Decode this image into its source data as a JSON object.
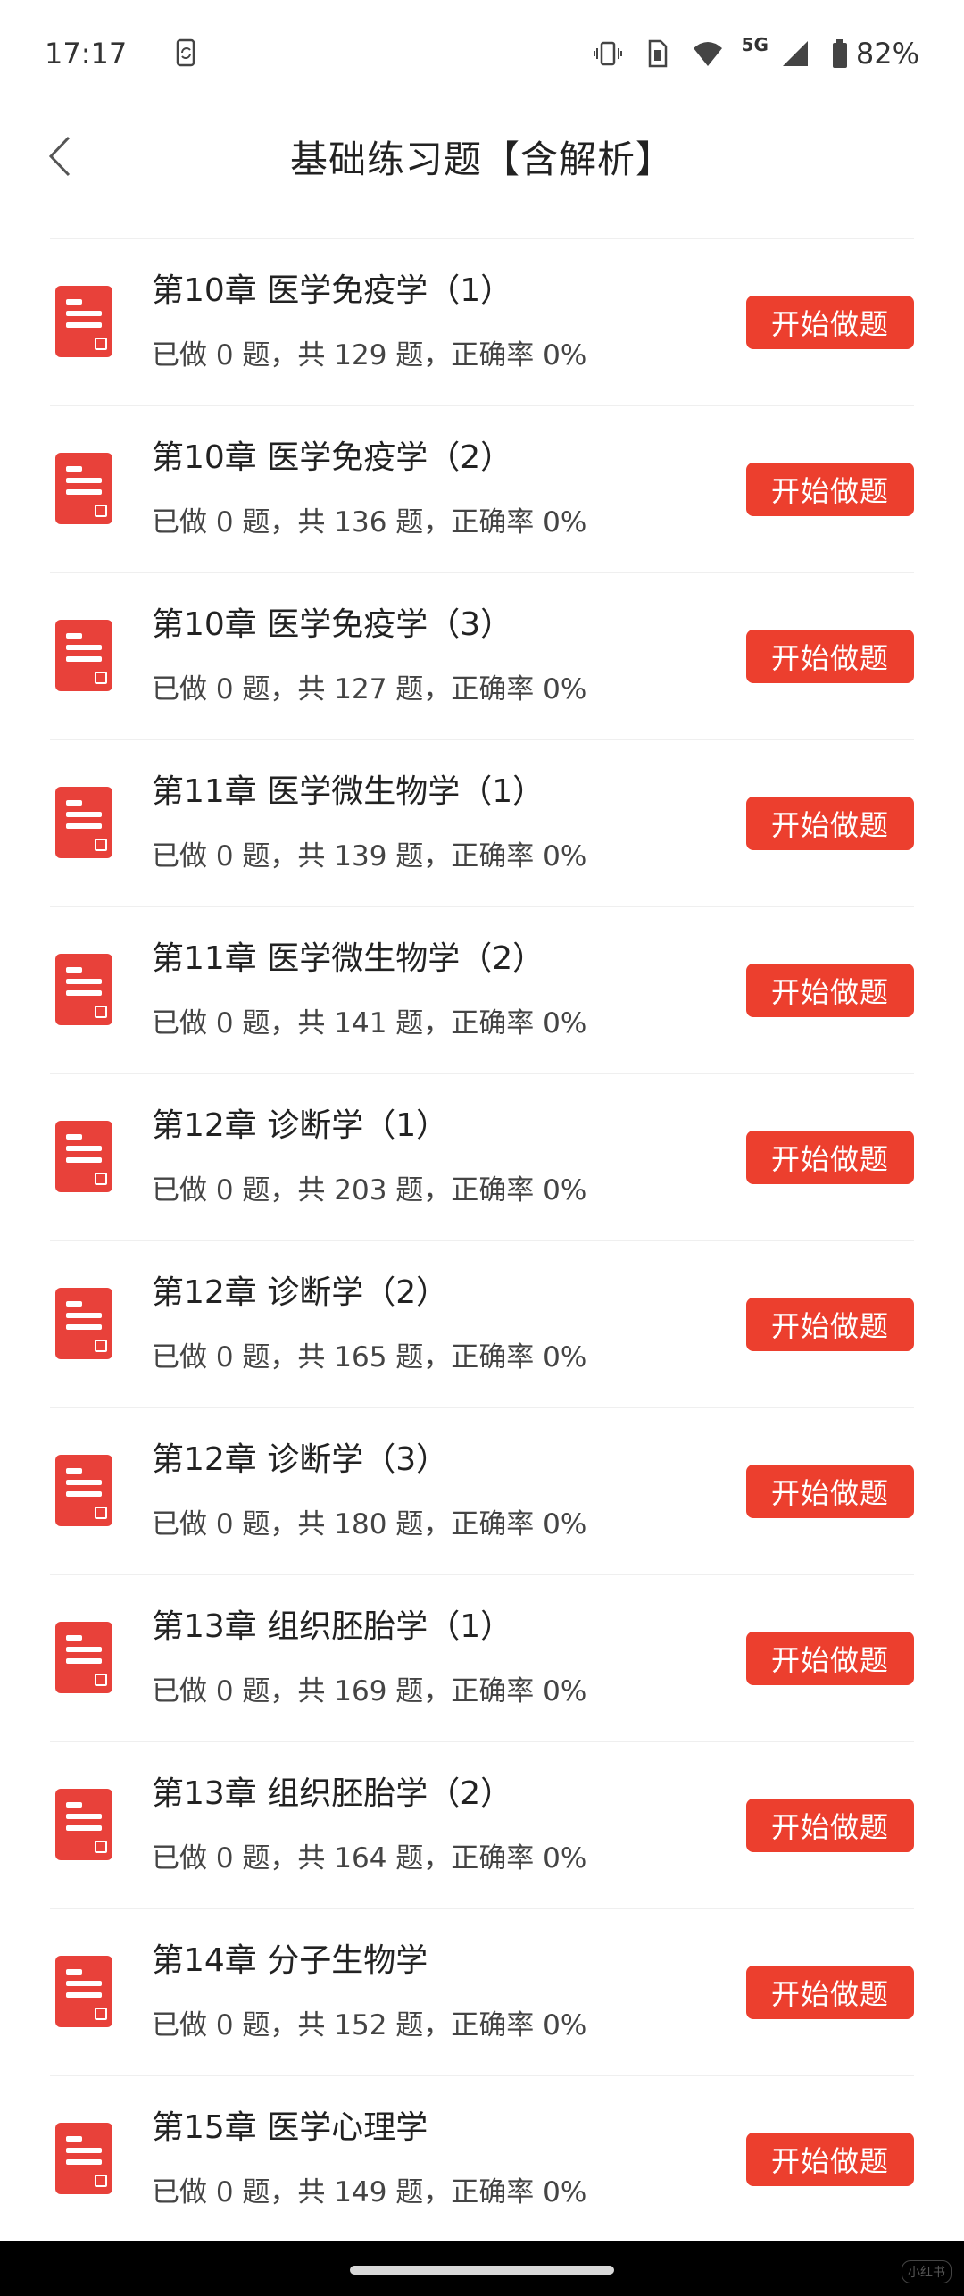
{
  "status_bar": {
    "time": "17:17",
    "network": "5G",
    "battery": "82%",
    "icons": [
      "phone-sync-icon",
      "vibrate-icon",
      "sim-icon",
      "wifi-icon",
      "signal-icon",
      "battery-icon"
    ]
  },
  "header": {
    "title": "基础练习题【含解析】",
    "back_icon": "chevron-left-icon"
  },
  "button_label": "开始做题",
  "items": [
    {
      "title": "第10章 医学免疫学（1）",
      "stats": "已做 0 题，共 129 题，正确率 0%"
    },
    {
      "title": "第10章 医学免疫学（2）",
      "stats": "已做 0 题，共 136 题，正确率 0%"
    },
    {
      "title": "第10章 医学免疫学（3）",
      "stats": "已做 0 题，共 127 题，正确率 0%"
    },
    {
      "title": "第11章 医学微生物学（1）",
      "stats": "已做 0 题，共 139 题，正确率 0%"
    },
    {
      "title": "第11章 医学微生物学（2）",
      "stats": "已做 0 题，共 141 题，正确率 0%"
    },
    {
      "title": "第12章 诊断学（1）",
      "stats": "已做 0 题，共 203 题，正确率 0%"
    },
    {
      "title": "第12章 诊断学（2）",
      "stats": "已做 0 题，共 165 题，正确率 0%"
    },
    {
      "title": "第12章 诊断学（3）",
      "stats": "已做 0 题，共 180 题，正确率 0%"
    },
    {
      "title": "第13章 组织胚胎学（1）",
      "stats": "已做 0 题，共 169 题，正确率 0%"
    },
    {
      "title": "第13章 组织胚胎学（2）",
      "stats": "已做 0 题，共 164 题，正确率 0%"
    },
    {
      "title": "第14章 分子生物学",
      "stats": "已做 0 题，共 152 题，正确率 0%"
    },
    {
      "title": "第15章 医学心理学",
      "stats": "已做 0 题，共 149 题，正确率 0%"
    }
  ],
  "colors": {
    "accent": "#ec3f2e",
    "icon": "#e8413a",
    "divider": "#efefef"
  },
  "nav_bar": {
    "watermark": "小红书"
  }
}
